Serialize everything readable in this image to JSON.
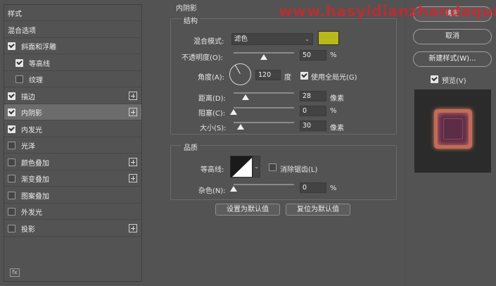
{
  "left_panel": {
    "items": [
      {
        "label": "样式",
        "checkbox": false,
        "checked": false,
        "indent": false,
        "plus": false,
        "selected": false
      },
      {
        "label": "混合选项",
        "checkbox": false,
        "checked": false,
        "indent": false,
        "plus": false,
        "selected": false
      },
      {
        "label": "斜面和浮雕",
        "checkbox": true,
        "checked": true,
        "indent": false,
        "plus": false,
        "selected": false
      },
      {
        "label": "等高线",
        "checkbox": true,
        "checked": true,
        "indent": true,
        "plus": false,
        "selected": false
      },
      {
        "label": "纹理",
        "checkbox": true,
        "checked": false,
        "indent": true,
        "plus": false,
        "selected": false
      },
      {
        "label": "描边",
        "checkbox": true,
        "checked": true,
        "indent": false,
        "plus": true,
        "selected": false
      },
      {
        "label": "内阴影",
        "checkbox": true,
        "checked": true,
        "indent": false,
        "plus": true,
        "selected": true
      },
      {
        "label": "内发光",
        "checkbox": true,
        "checked": true,
        "indent": false,
        "plus": false,
        "selected": false
      },
      {
        "label": "光泽",
        "checkbox": true,
        "checked": false,
        "indent": false,
        "plus": false,
        "selected": false
      },
      {
        "label": "颜色叠加",
        "checkbox": true,
        "checked": false,
        "indent": false,
        "plus": true,
        "selected": false
      },
      {
        "label": "渐变叠加",
        "checkbox": true,
        "checked": false,
        "indent": false,
        "plus": true,
        "selected": false
      },
      {
        "label": "图案叠加",
        "checkbox": true,
        "checked": false,
        "indent": false,
        "plus": false,
        "selected": false
      },
      {
        "label": "外发光",
        "checkbox": true,
        "checked": false,
        "indent": false,
        "plus": false,
        "selected": false
      },
      {
        "label": "投影",
        "checkbox": true,
        "checked": false,
        "indent": false,
        "plus": true,
        "selected": false
      }
    ],
    "bottom_icon": "fx"
  },
  "panel": {
    "title": "内阴影",
    "structure": {
      "title": "结构",
      "blend_mode_label": "混合模式:",
      "blend_mode_value": "滤色",
      "color": "#b8b81a",
      "opacity_label": "不透明度(O):",
      "opacity_value": "50",
      "opacity_unit": "%",
      "opacity_fraction": 0.5,
      "angle_label": "角度(A):",
      "angle_value": "120",
      "angle_unit": "度",
      "global_light_label": "使用全局光(G)",
      "global_light_checked": true,
      "distance_label": "距离(D):",
      "distance_value": "28",
      "distance_unit": "像素",
      "distance_fraction": 0.2,
      "choke_label": "阻塞(C):",
      "choke_value": "0",
      "choke_unit": "%",
      "choke_fraction": 0,
      "size_label": "大小(S):",
      "size_value": "30",
      "size_unit": "像素",
      "size_fraction": 0.12
    },
    "quality": {
      "title": "品质",
      "contour_label": "等高线:",
      "antialias_label": "消除锯齿(L)",
      "antialias_checked": false,
      "noise_label": "杂色(N):",
      "noise_value": "0",
      "noise_unit": "%",
      "noise_fraction": 0
    },
    "set_default_label": "设置为默认值",
    "reset_default_label": "复位为默认值"
  },
  "right": {
    "ok_label": "确定",
    "cancel_label": "取消",
    "new_style_label": "新建样式(W)...",
    "preview_label": "预览(V)",
    "preview_checked": true
  },
  "watermark": "www.hasyidianzhandaqun"
}
